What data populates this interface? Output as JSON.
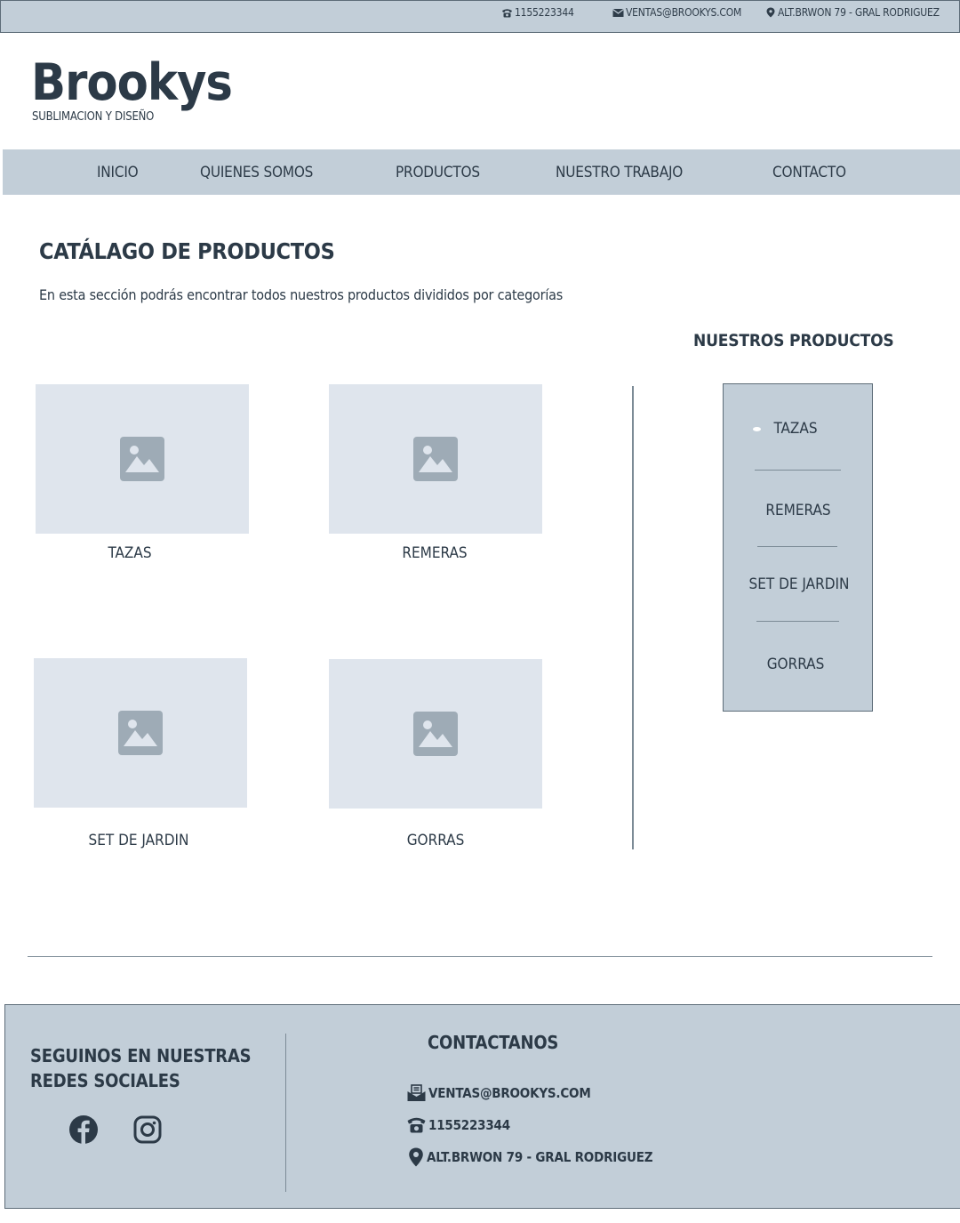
{
  "colors": {
    "panel": "#c2ced8",
    "text": "#2c3a47",
    "placeholder_bg": "#dfe5ed",
    "placeholder_icon": "#9eabb6",
    "divider": "#7c8b96"
  },
  "topbar": {
    "phone": "1155223344",
    "email": "VENTAS@BROOKYS.COM",
    "address": "ALT.BRWON 79 - GRAL RODRIGUEZ",
    "icons": [
      "phone-icon",
      "mail-icon",
      "location-pin-icon"
    ]
  },
  "header": {
    "logo": "Brookys",
    "tagline": "SUBLIMACION Y DISEÑO"
  },
  "nav": {
    "items": [
      {
        "label": "INICIO"
      },
      {
        "label": "QUIENES SOMOS"
      },
      {
        "label": "PRODUCTOS"
      },
      {
        "label": "NUESTRO TRABAJO"
      },
      {
        "label": "CONTACTO"
      }
    ]
  },
  "main": {
    "title": "CATÁLAGO DE PRODUCTOS",
    "intro": "En esta sección podrás encontrar todos nuestros productos divididos por categorías",
    "products": [
      {
        "label": "TAZAS",
        "icon": "image-placeholder-icon"
      },
      {
        "label": "REMERAS",
        "icon": "image-placeholder-icon"
      },
      {
        "label": "SET DE JARDIN",
        "icon": "image-placeholder-icon"
      },
      {
        "label": "GORRAS",
        "icon": "image-placeholder-icon"
      }
    ]
  },
  "sidebar": {
    "title": "NUESTROS PRODUCTOS",
    "items": [
      {
        "label": "TAZAS",
        "active": true
      },
      {
        "label": "REMERAS"
      },
      {
        "label": "SET DE JARDIN"
      },
      {
        "label": "GORRAS"
      }
    ]
  },
  "footer": {
    "social_title_line1": "SEGUINOS EN NUESTRAS",
    "social_title_line2": "REDES SOCIALES",
    "social_icons": [
      "facebook-icon",
      "instagram-icon"
    ],
    "contact_title": "CONTACTANOS",
    "email": "VENTAS@BROOKYS.COM",
    "phone": "1155223344",
    "address": "ALT.BRWON 79 - GRAL RODRIGUEZ"
  }
}
